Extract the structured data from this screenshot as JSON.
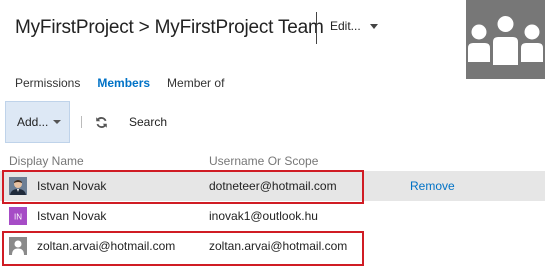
{
  "header": {
    "title": "MyFirstProject > MyFirstProject Team",
    "edit_label": "Edit..."
  },
  "tabs": [
    {
      "label": "Permissions",
      "active": false
    },
    {
      "label": "Members",
      "active": true
    },
    {
      "label": "Member of",
      "active": false
    }
  ],
  "toolbar": {
    "add_label": "Add...",
    "search_label": "Search"
  },
  "table": {
    "columns": [
      "Display Name",
      "Username Or Scope"
    ],
    "rows": [
      {
        "display_name": "Istvan Novak",
        "username": "dotneteer@hotmail.com",
        "action": "Remove",
        "selected": true,
        "avatar": "photo-avatar-icon"
      },
      {
        "display_name": "Istvan Novak",
        "username": "inovak1@outlook.hu",
        "action": "",
        "selected": false,
        "avatar": "initials-avatar-icon",
        "initials": "IN"
      },
      {
        "display_name": "zoltan.arvai@hotmail.com",
        "username": "zoltan.arvai@hotmail.com",
        "action": "",
        "selected": false,
        "avatar": "default-person-icon"
      }
    ]
  },
  "colors": {
    "accent": "#0072c6",
    "highlight": "#d01c24",
    "selected_row": "#e6e6e6",
    "add_button_bg": "#dde8f5"
  }
}
